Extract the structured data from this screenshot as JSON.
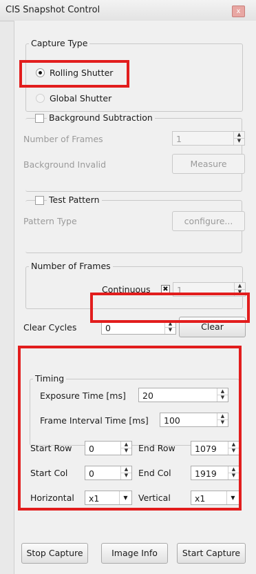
{
  "window": {
    "title": "CIS Snapshot Control",
    "close_glyph": "x"
  },
  "capture_type": {
    "title": "Capture Type",
    "rolling": "Rolling Shutter",
    "global": "Global Shutter"
  },
  "background": {
    "title": "Background Subtraction",
    "frames_label": "Number of Frames",
    "frames_value": "1",
    "invalid_label": "Background Invalid",
    "measure": "Measure"
  },
  "test_pattern": {
    "title": "Test Pattern",
    "type_label": "Pattern Type",
    "configure": "configure..."
  },
  "num_frames": {
    "title": "Number of Frames",
    "continuous": "Continuous",
    "check_glyph": "✖",
    "value": "1"
  },
  "clear_cycles": {
    "label": "Clear Cycles",
    "value": "0",
    "button": "Clear"
  },
  "timing": {
    "title": "Timing",
    "exposure_label": "Exposure Time [ms]",
    "exposure_value": "20",
    "interval_label": "Frame Interval Time [ms]",
    "interval_value": "100"
  },
  "roi": {
    "start_row_label": "Start Row",
    "start_row": "0",
    "end_row_label": "End Row",
    "end_row": "1079",
    "start_col_label": "Start Col",
    "start_col": "0",
    "end_col_label": "End Col",
    "end_col": "1919",
    "horizontal_label": "Horizontal",
    "horizontal": "x1",
    "vertical_label": "Vertical",
    "vertical": "x1"
  },
  "buttons": {
    "stop": "Stop Capture",
    "info": "Image Info",
    "start": "Start Capture"
  },
  "glyphs": {
    "up": "▲",
    "down": "▼"
  },
  "colors": {
    "highlight": "#e21d1d"
  }
}
